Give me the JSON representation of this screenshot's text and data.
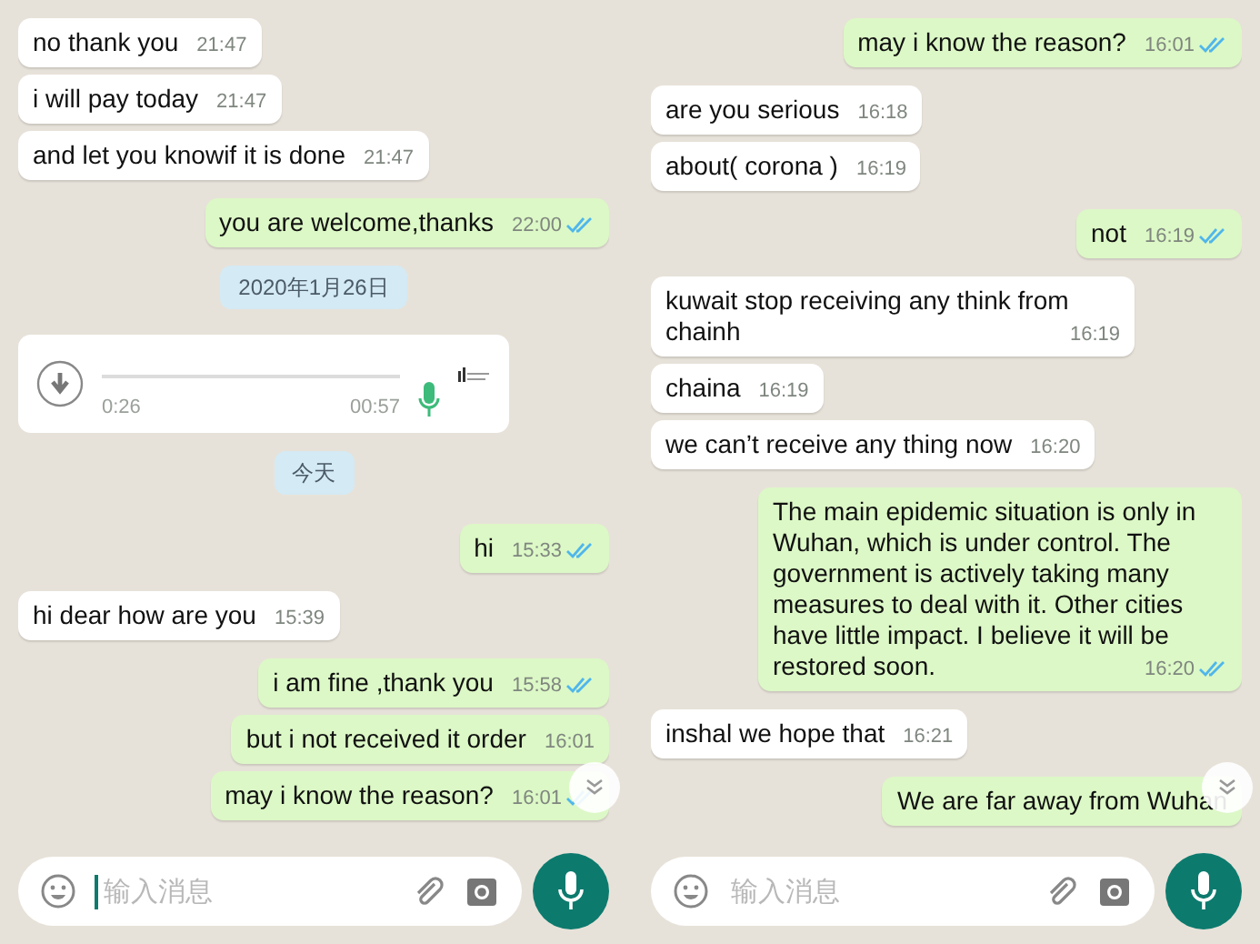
{
  "panels": [
    {
      "messages": [
        {
          "kind": "in",
          "text": "no thank you",
          "time": "21:47"
        },
        {
          "kind": "in",
          "text": "i will pay today",
          "time": "21:47"
        },
        {
          "kind": "in",
          "text": "and let you knowif it is done",
          "time": "21:47"
        },
        {
          "kind": "out",
          "text": "you are welcome,thanks",
          "time": "22:00",
          "read": true
        },
        {
          "kind": "date",
          "text": "2020年1月26日"
        },
        {
          "kind": "voice",
          "elapsed": "0:26",
          "duration": "00:57"
        },
        {
          "kind": "date",
          "text": "今天"
        },
        {
          "kind": "out",
          "text": "hi",
          "time": "15:33",
          "read": true
        },
        {
          "kind": "in",
          "text": "hi dear how are you",
          "time": "15:39"
        },
        {
          "kind": "out",
          "text": "i am fine ,thank you",
          "time": "15:58",
          "read": true
        },
        {
          "kind": "out",
          "text": "but i not received it order",
          "time": "16:01",
          "read": false
        },
        {
          "kind": "out",
          "text": "may i know the reason?",
          "time": "16:01",
          "read": true
        }
      ],
      "input": {
        "placeholder": "输入消息",
        "focused": true
      }
    },
    {
      "messages": [
        {
          "kind": "out",
          "text": "may i know the reason?",
          "time": "16:01",
          "read": true
        },
        {
          "kind": "in",
          "text": "are you serious",
          "time": "16:18"
        },
        {
          "kind": "in",
          "text": "about( corona )",
          "time": "16:19"
        },
        {
          "kind": "out",
          "text": "not",
          "time": "16:19",
          "read": true
        },
        {
          "kind": "in",
          "text": "kuwait stop receiving any think from chainh",
          "time": "16:19"
        },
        {
          "kind": "in",
          "text": "chaina",
          "time": "16:19"
        },
        {
          "kind": "in",
          "text": "we can’t receive any thing now",
          "time": "16:20"
        },
        {
          "kind": "out",
          "text": "The main epidemic situation is only in Wuhan, which is under control. The government is actively taking many measures to deal with it. Other cities have little impact. I believe it will be restored soon.",
          "time": "16:20",
          "read": true
        },
        {
          "kind": "in",
          "text": "inshal we hope that",
          "time": "16:21"
        },
        {
          "kind": "out",
          "text": "We are far away from Wuhan"
        }
      ],
      "input": {
        "placeholder": "输入消息",
        "focused": false
      }
    }
  ]
}
